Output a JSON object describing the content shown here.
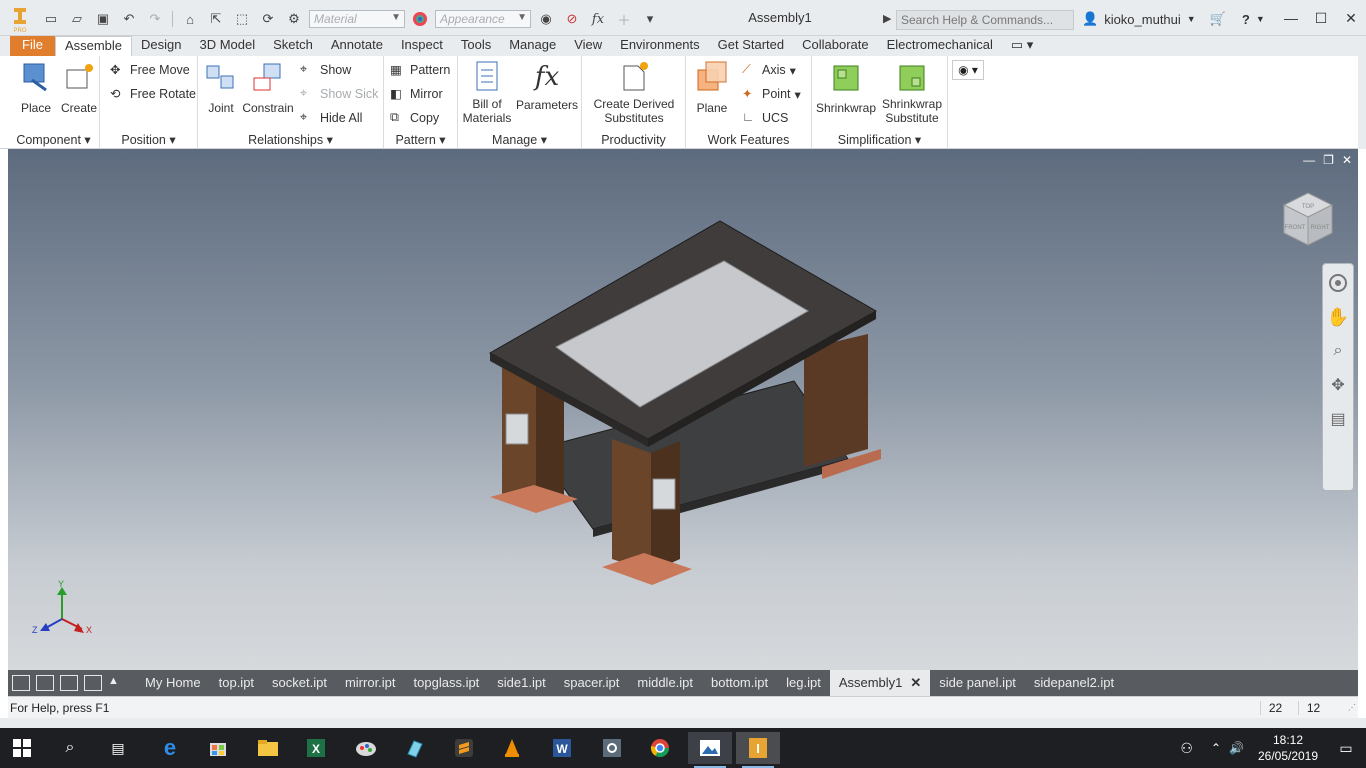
{
  "titlebar": {
    "app_badge": "PRO",
    "material_placeholder": "Material",
    "appearance_placeholder": "Appearance",
    "fx_label": "fx",
    "document_title": "Assembly1",
    "search_placeholder": "Search Help & Commands...",
    "user_name": "kioko_muthui"
  },
  "ribbon_tabs": [
    "File",
    "Assemble",
    "Design",
    "3D Model",
    "Sketch",
    "Annotate",
    "Inspect",
    "Tools",
    "Manage",
    "View",
    "Environments",
    "Get Started",
    "Collaborate",
    "Electromechanical"
  ],
  "active_tab": "Assemble",
  "panels": {
    "component": {
      "label": "Component",
      "place": "Place",
      "create": "Create"
    },
    "position": {
      "label": "Position",
      "free_move": "Free Move",
      "free_rotate": "Free Rotate"
    },
    "relationships": {
      "label": "Relationships",
      "joint": "Joint",
      "constrain": "Constrain",
      "show": "Show",
      "show_sick": "Show Sick",
      "hide_all": "Hide All"
    },
    "pattern": {
      "label": "Pattern",
      "pattern": "Pattern",
      "mirror": "Mirror",
      "copy": "Copy"
    },
    "manage": {
      "label": "Manage",
      "bom_line1": "Bill of",
      "bom_line2": "Materials",
      "parameters": "Parameters"
    },
    "productivity": {
      "label": "Productivity",
      "line1": "Create Derived",
      "line2": "Substitutes"
    },
    "work_features": {
      "label": "Work Features",
      "plane": "Plane",
      "axis": "Axis",
      "point": "Point",
      "ucs": "UCS"
    },
    "simplification": {
      "label": "Simplification",
      "shrinkwrap": "Shrinkwrap",
      "sws_line1": "Shrinkwrap",
      "sws_line2": "Substitute"
    }
  },
  "viewcube": {
    "top": "TOP",
    "front": "FRONT",
    "right": "RIGHT"
  },
  "triad": {
    "x": "X",
    "y": "Y",
    "z": "Z"
  },
  "doc_tabs": [
    "My Home",
    "top.ipt",
    "socket.ipt",
    "mirror.ipt",
    "topglass.ipt",
    "side1.ipt",
    "spacer.ipt",
    "middle.ipt",
    "bottom.ipt",
    "leg.ipt",
    "Assembly1",
    "side panel.ipt",
    "sidepanel2.ipt"
  ],
  "active_doc": "Assembly1",
  "status": {
    "help": "For Help, press F1",
    "count1": "22",
    "count2": "12"
  },
  "clock": {
    "time": "18:12",
    "date": "26/05/2019"
  },
  "colors": {
    "file_tab": "#e17e2e",
    "viewport_top": "#5d6b7e",
    "viewport_bottom": "#d6d9dc"
  }
}
